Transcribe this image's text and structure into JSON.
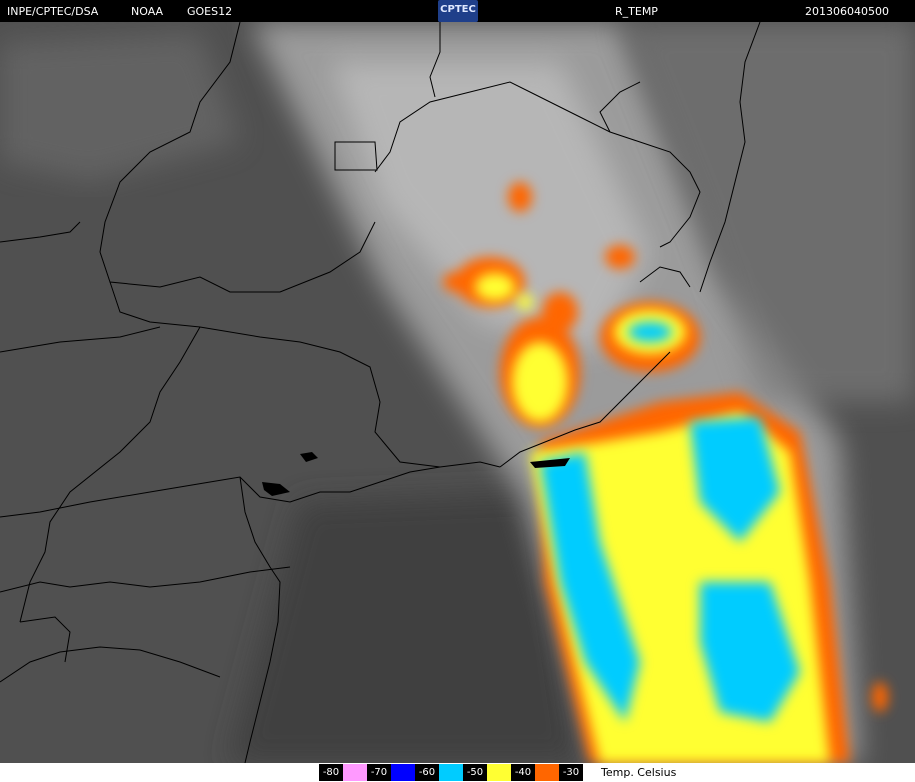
{
  "header": {
    "source": "INPE/CPTEC/DSA",
    "agency": "NOAA",
    "satellite": "GOES12",
    "logo_text": "CPTEC",
    "product": "R_TEMP",
    "timestamp": "201306040500"
  },
  "legend": {
    "title": "Temp. Celsius",
    "items": [
      {
        "label": "-80",
        "color": "#ff99ff"
      },
      {
        "label": "-70",
        "color": "#0000ff"
      },
      {
        "label": "-60",
        "color": "#00ccff"
      },
      {
        "label": "-50",
        "color": "#ffff33"
      },
      {
        "label": "-40",
        "color": "#ff6600"
      },
      {
        "label": "-30",
        "color": "#ffffff"
      }
    ]
  },
  "map": {
    "background_color": "#525252",
    "cloud_color": "#bdbdbd",
    "border_color": "#000000"
  }
}
